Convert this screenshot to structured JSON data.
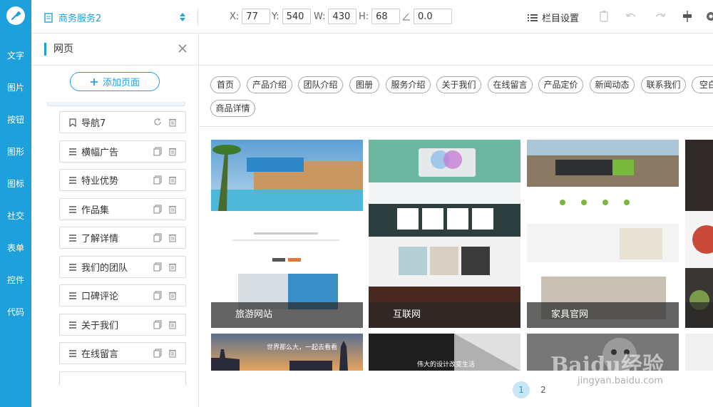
{
  "rail": {
    "items": [
      "文字",
      "图片",
      "按钮",
      "图形",
      "图标",
      "社交",
      "表单",
      "控件",
      "代码"
    ]
  },
  "toolbar": {
    "page_name": "商务服务2",
    "x_label": "X:",
    "x_value": "77",
    "y_label": "Y:",
    "y_value": "540",
    "w_label": "W:",
    "w_value": "430",
    "h_label": "H:",
    "h_value": "68",
    "angle_value": "0.0",
    "column_settings": "栏目设置"
  },
  "panel": {
    "title": "网页",
    "add_page": "添加页面",
    "items": [
      {
        "label": "导航7",
        "kind": "bookmark"
      },
      {
        "label": "横幅广告",
        "kind": "list"
      },
      {
        "label": "特业优势",
        "kind": "list"
      },
      {
        "label": "作品集",
        "kind": "list"
      },
      {
        "label": "了解详情",
        "kind": "list"
      },
      {
        "label": "我们的团队",
        "kind": "list"
      },
      {
        "label": "口碑评论",
        "kind": "list"
      },
      {
        "label": "关于我们",
        "kind": "list"
      },
      {
        "label": "在线留言",
        "kind": "list"
      }
    ]
  },
  "tags": [
    "首页",
    "产品介绍",
    "团队介绍",
    "图册",
    "服务介绍",
    "关于我们",
    "在线留言",
    "产品定价",
    "新闻动态",
    "联系我们",
    "空白",
    "商品详情"
  ],
  "templates": [
    {
      "caption": "旅游网站"
    },
    {
      "caption": "互联网"
    },
    {
      "caption": "家具官网"
    },
    {
      "caption": ""
    },
    {
      "caption": "世界那么大，一起去看看"
    },
    {
      "caption": "伟大的设计改变生活"
    },
    {
      "caption": ""
    },
    {
      "caption": ""
    }
  ],
  "pagination": [
    "1",
    "2"
  ],
  "watermark": {
    "logo": "Baidu经验",
    "url": "jingyan.baidu.com"
  },
  "colors": {
    "accent": "#1ea0dc"
  }
}
